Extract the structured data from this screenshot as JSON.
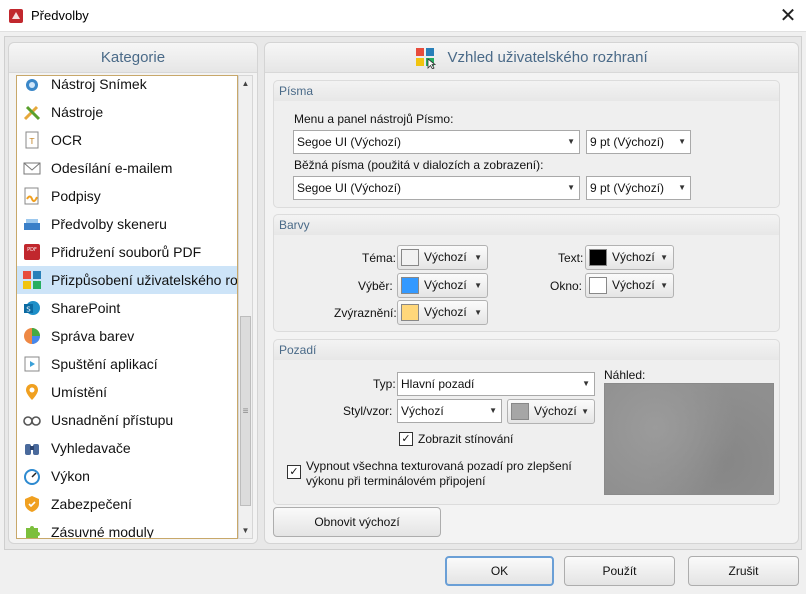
{
  "window": {
    "title": "Předvolby"
  },
  "left_panel": {
    "heading": "Kategorie",
    "items": [
      {
        "label": "Nástroj Snímek",
        "icon": "camera-icon"
      },
      {
        "label": "Nástroje",
        "icon": "tools-icon"
      },
      {
        "label": "OCR",
        "icon": "ocr-icon"
      },
      {
        "label": "Odesílání e-mailem",
        "icon": "envelope-icon"
      },
      {
        "label": "Podpisy",
        "icon": "signature-icon"
      },
      {
        "label": "Předvolby skeneru",
        "icon": "scanner-icon"
      },
      {
        "label": "Přidružení souborů PDF",
        "icon": "pdf-icon"
      },
      {
        "label": "Přizpůsobení uživatelského roz",
        "icon": "customize-ui-icon",
        "selected": true
      },
      {
        "label": "SharePoint",
        "icon": "sharepoint-icon"
      },
      {
        "label": "Správa barev",
        "icon": "color-wheel-icon"
      },
      {
        "label": "Spuštění aplikací",
        "icon": "launch-icon"
      },
      {
        "label": "Umístění",
        "icon": "location-pin-icon"
      },
      {
        "label": "Usnadnění přístupu",
        "icon": "glasses-icon"
      },
      {
        "label": "Vyhledavače",
        "icon": "binoculars-icon"
      },
      {
        "label": "Výkon",
        "icon": "speedometer-icon"
      },
      {
        "label": "Zabezpečení",
        "icon": "shield-icon"
      },
      {
        "label": "Zásuvné moduly",
        "icon": "puzzle-icon"
      }
    ]
  },
  "right_panel": {
    "heading": "Vzhled uživatelského rozhraní",
    "fonts": {
      "title": "Písma",
      "menu_label": "Menu a panel nástrojů Písmo:",
      "menu_font": "Segoe UI (Výchozí)",
      "menu_size": "9 pt (Výchozí)",
      "common_label": "Běžná písma (použitá v dialozích a zobrazení):",
      "common_font": "Segoe UI (Výchozí)",
      "common_size": "9 pt (Výchozí)"
    },
    "colors": {
      "title": "Barvy",
      "theme_label": "Téma:",
      "theme_value": "Výchozí",
      "theme_color": "#f2f2f2",
      "selection_label": "Výběr:",
      "selection_value": "Výchozí",
      "selection_color": "#3399ff",
      "highlight_label": "Zvýraznění:",
      "highlight_value": "Výchozí",
      "highlight_color": "#ffd77a",
      "text_label": "Text:",
      "text_value": "Výchozí",
      "text_color": "#000000",
      "window_label": "Okno:",
      "window_value": "Výchozí",
      "window_color": "#ffffff"
    },
    "background": {
      "title": "Pozadí",
      "type_label": "Typ:",
      "type_value": "Hlavní pozadí",
      "style_label": "Styl/vzor:",
      "style_value": "Výchozí",
      "style_color_value": "Výchozí",
      "style_color": "#a6a6a6",
      "shadow_label": "Zobrazit stínování",
      "shadow_checked": true,
      "preview_label": "Náhled:",
      "disable_textures_line1": "Vypnout všechna texturovaná pozadí pro zlepšení",
      "disable_textures_line2": "výkonu při terminálovém připojení",
      "disable_textures_checked": true
    },
    "reset_label": "Obnovit výchozí"
  },
  "footer": {
    "ok": "OK",
    "apply": "Použít",
    "cancel": "Zrušit"
  }
}
